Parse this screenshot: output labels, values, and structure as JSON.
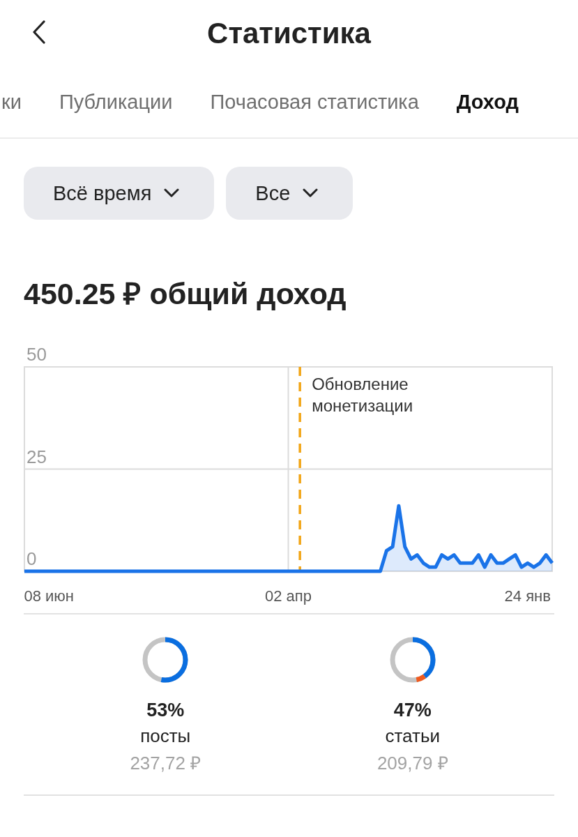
{
  "header": {
    "title": "Статистика"
  },
  "tabs": [
    {
      "label": "ки",
      "selected": false
    },
    {
      "label": "Публикации",
      "selected": false
    },
    {
      "label": "Почасовая статистика",
      "selected": false
    },
    {
      "label": "Доход",
      "selected": true
    }
  ],
  "filters": [
    {
      "label": "Всё время"
    },
    {
      "label": "Все"
    }
  ],
  "total": "450.25 ₽ общий доход",
  "chart": {
    "chart_data": {
      "type": "area",
      "categories": [
        null,
        null,
        null,
        null,
        "08 июн",
        null,
        null,
        null,
        null,
        null,
        null,
        null,
        null,
        null,
        null,
        null,
        null,
        null,
        null,
        null,
        null,
        null,
        null,
        null,
        null,
        null,
        null,
        null,
        null,
        null,
        null,
        null,
        null,
        null,
        null,
        null,
        null,
        null,
        null,
        null,
        null,
        null,
        null,
        "02 апр",
        null,
        null,
        null,
        null,
        null,
        null,
        null,
        null,
        null,
        null,
        null,
        null,
        null,
        null,
        null,
        null,
        null,
        null,
        null,
        null,
        null,
        null,
        null,
        null,
        null,
        null,
        null,
        null,
        null,
        null,
        null,
        null,
        null,
        null,
        null,
        null,
        null,
        null,
        "24 янв",
        null,
        null,
        null,
        null
      ],
      "series": [
        {
          "color": "#1a73e8",
          "values": [
            0,
            0,
            0,
            0,
            0,
            0,
            0,
            0,
            0,
            0,
            0,
            0,
            0,
            0,
            0,
            0,
            0,
            0,
            0,
            0,
            0,
            0,
            0,
            0,
            0,
            0,
            0,
            0,
            0,
            0,
            0,
            0,
            0,
            0,
            0,
            0,
            0,
            0,
            0,
            0,
            0,
            0,
            0,
            0,
            0,
            0,
            0,
            0,
            0,
            0,
            0,
            0,
            0,
            0,
            0,
            0,
            0,
            0,
            0,
            5,
            6,
            16,
            6,
            3,
            4,
            2,
            1,
            1,
            4,
            3,
            4,
            2,
            2,
            2,
            4,
            1,
            4,
            2,
            2,
            3,
            4,
            1,
            2,
            1,
            2,
            4,
            2
          ]
        }
      ],
      "ylim": [
        0,
        50
      ],
      "yticks": [
        0,
        25,
        50
      ],
      "annotations": [
        "Обновление монетизации"
      ]
    }
  },
  "stats": [
    {
      "percent": "53%",
      "label": "посты",
      "amount": "237,72 ₽",
      "segments": [
        {
          "color": "#0a6ee0",
          "level": 0.53
        }
      ]
    },
    {
      "percent": "47%",
      "label": "статьи",
      "amount": "209,79 ₽",
      "segments": [
        {
          "color": "#0a6ee0",
          "level": 0.4
        },
        {
          "color": "#f05a1e",
          "level": 0.07
        }
      ]
    }
  ]
}
